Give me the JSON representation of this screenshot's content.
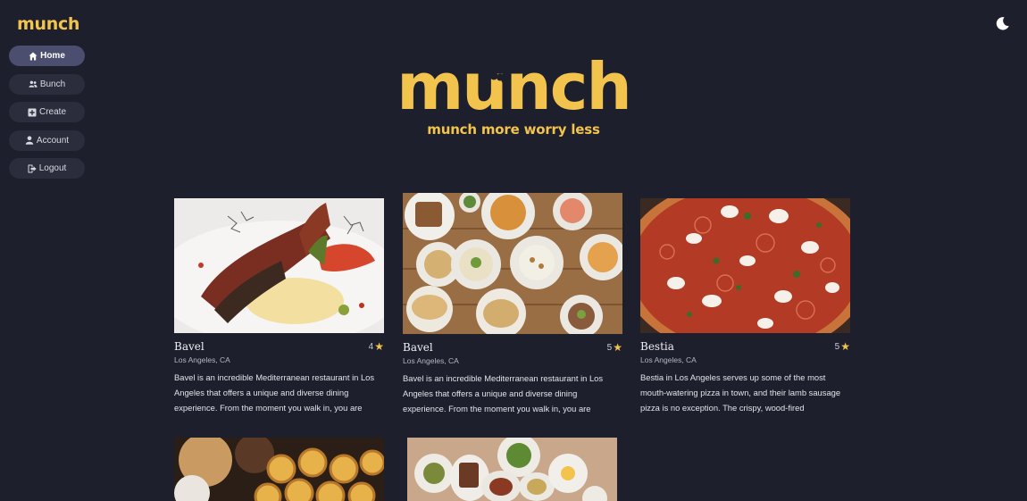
{
  "sidebar": {
    "brand": "munch",
    "items": [
      {
        "label": "Home",
        "icon": "home-icon",
        "active": true
      },
      {
        "label": "Bunch",
        "icon": "group-icon",
        "active": false
      },
      {
        "label": "Create",
        "icon": "plus-square-icon",
        "active": false
      },
      {
        "label": "Account",
        "icon": "user-icon",
        "active": false
      },
      {
        "label": "Logout",
        "icon": "logout-icon",
        "active": false
      }
    ]
  },
  "header": {
    "logo_text": "munch",
    "tagline": "munch more worry less",
    "theme_toggle_icon": "moon-icon"
  },
  "colors": {
    "background": "#1e1f2c",
    "accent": "#f2c34d",
    "nav_active": "#4b4e6e",
    "nav_inactive": "#2b2d3d"
  },
  "cards": [
    {
      "title": "Bavel",
      "rating": "4",
      "location": "Los Angeles, CA",
      "description": "Bavel is an incredible Mediterranean restaurant in Los Angeles that offers a unique and diverse dining experience. From the moment you walk in, you are",
      "image": "plated-dish-photo"
    },
    {
      "title": "Bavel",
      "rating": "5",
      "location": "Los Angeles, CA",
      "description": "Bavel is an incredible Mediterranean restaurant in Los Angeles that offers a unique and diverse dining experience. From the moment you walk in, you are",
      "image": "mezze-spread-photo"
    },
    {
      "title": "Bestia",
      "rating": "5",
      "location": "Los Angeles, CA",
      "description": "Bestia in Los Angeles serves up some of the most mouth-watering pizza in town, and their lamb sausage pizza is no exception. The crispy, wood-fired",
      "image": "pizza-photo"
    },
    {
      "image": "pastries-photo"
    },
    {
      "image": "shared-plates-photo"
    }
  ]
}
